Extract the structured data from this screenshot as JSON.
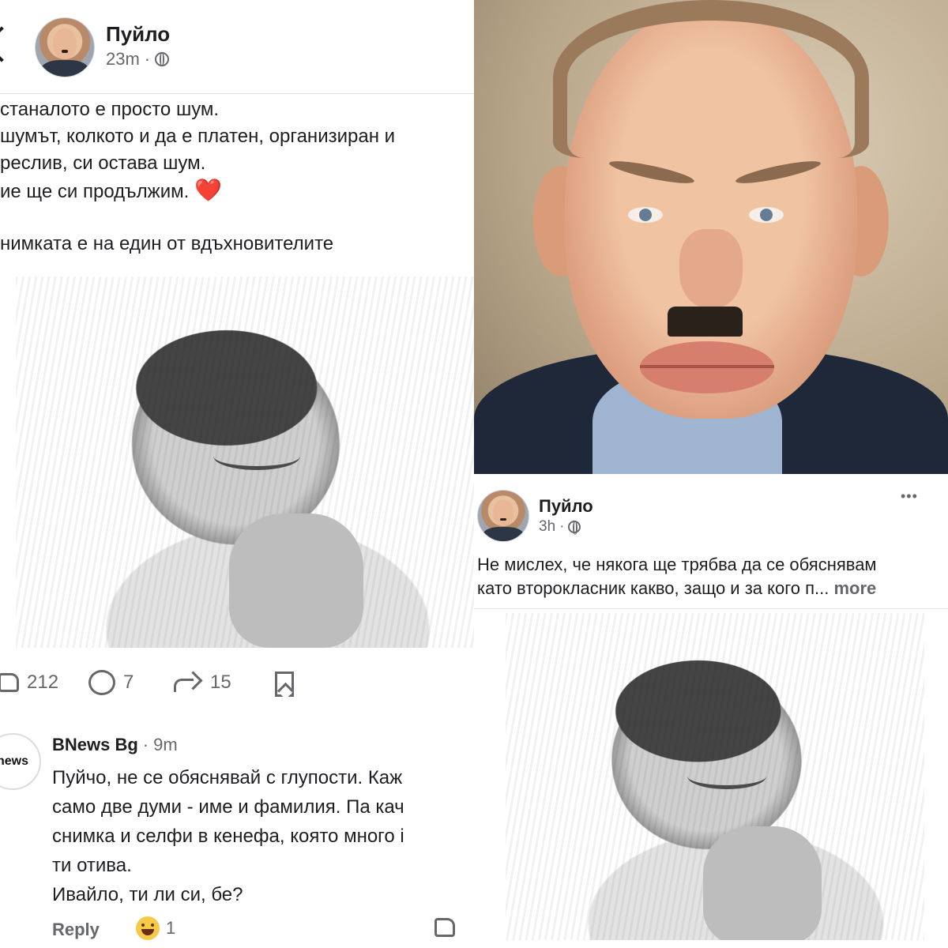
{
  "left_post": {
    "author": "Пуйло",
    "time": "23m",
    "separator": "·",
    "audience_icon": "globe-icon",
    "text_lines": [
      "станалото е просто шум.",
      "шумът, колкото и да е платен, организиран и",
      "реслив, си остава шум.",
      "ие ще си продължим.",
      "нимката е на един от вдъхновителите"
    ],
    "heart": "❤️",
    "actions": {
      "likes": "212",
      "comments": "7",
      "shares": "15"
    },
    "comment": {
      "author": "BNews Bg",
      "time": "9m",
      "separator": "·",
      "logo_text": "news",
      "lines": [
        "Пуйчо, не се обяснявай с глупости. Каж",
        "само две думи - име и фамилия. Па кач",
        "снимка и селфи в кенефа, която много і",
        "ти отива.",
        "Ивайло, ти ли си, бе?"
      ],
      "reply_label": "Reply",
      "reaction_count": "1"
    }
  },
  "right_post": {
    "author": "Пуйло",
    "time": "3h",
    "separator": "·",
    "options": "•••",
    "text_lines": [
      "Не мислех, че някога ще трябва да се обяснявам",
      "като второкласник какво, защо и за кого п..."
    ],
    "more_label": "more"
  },
  "colors": {
    "text": "#1c1e21",
    "meta": "#65676b",
    "heart": "#e0242e"
  }
}
